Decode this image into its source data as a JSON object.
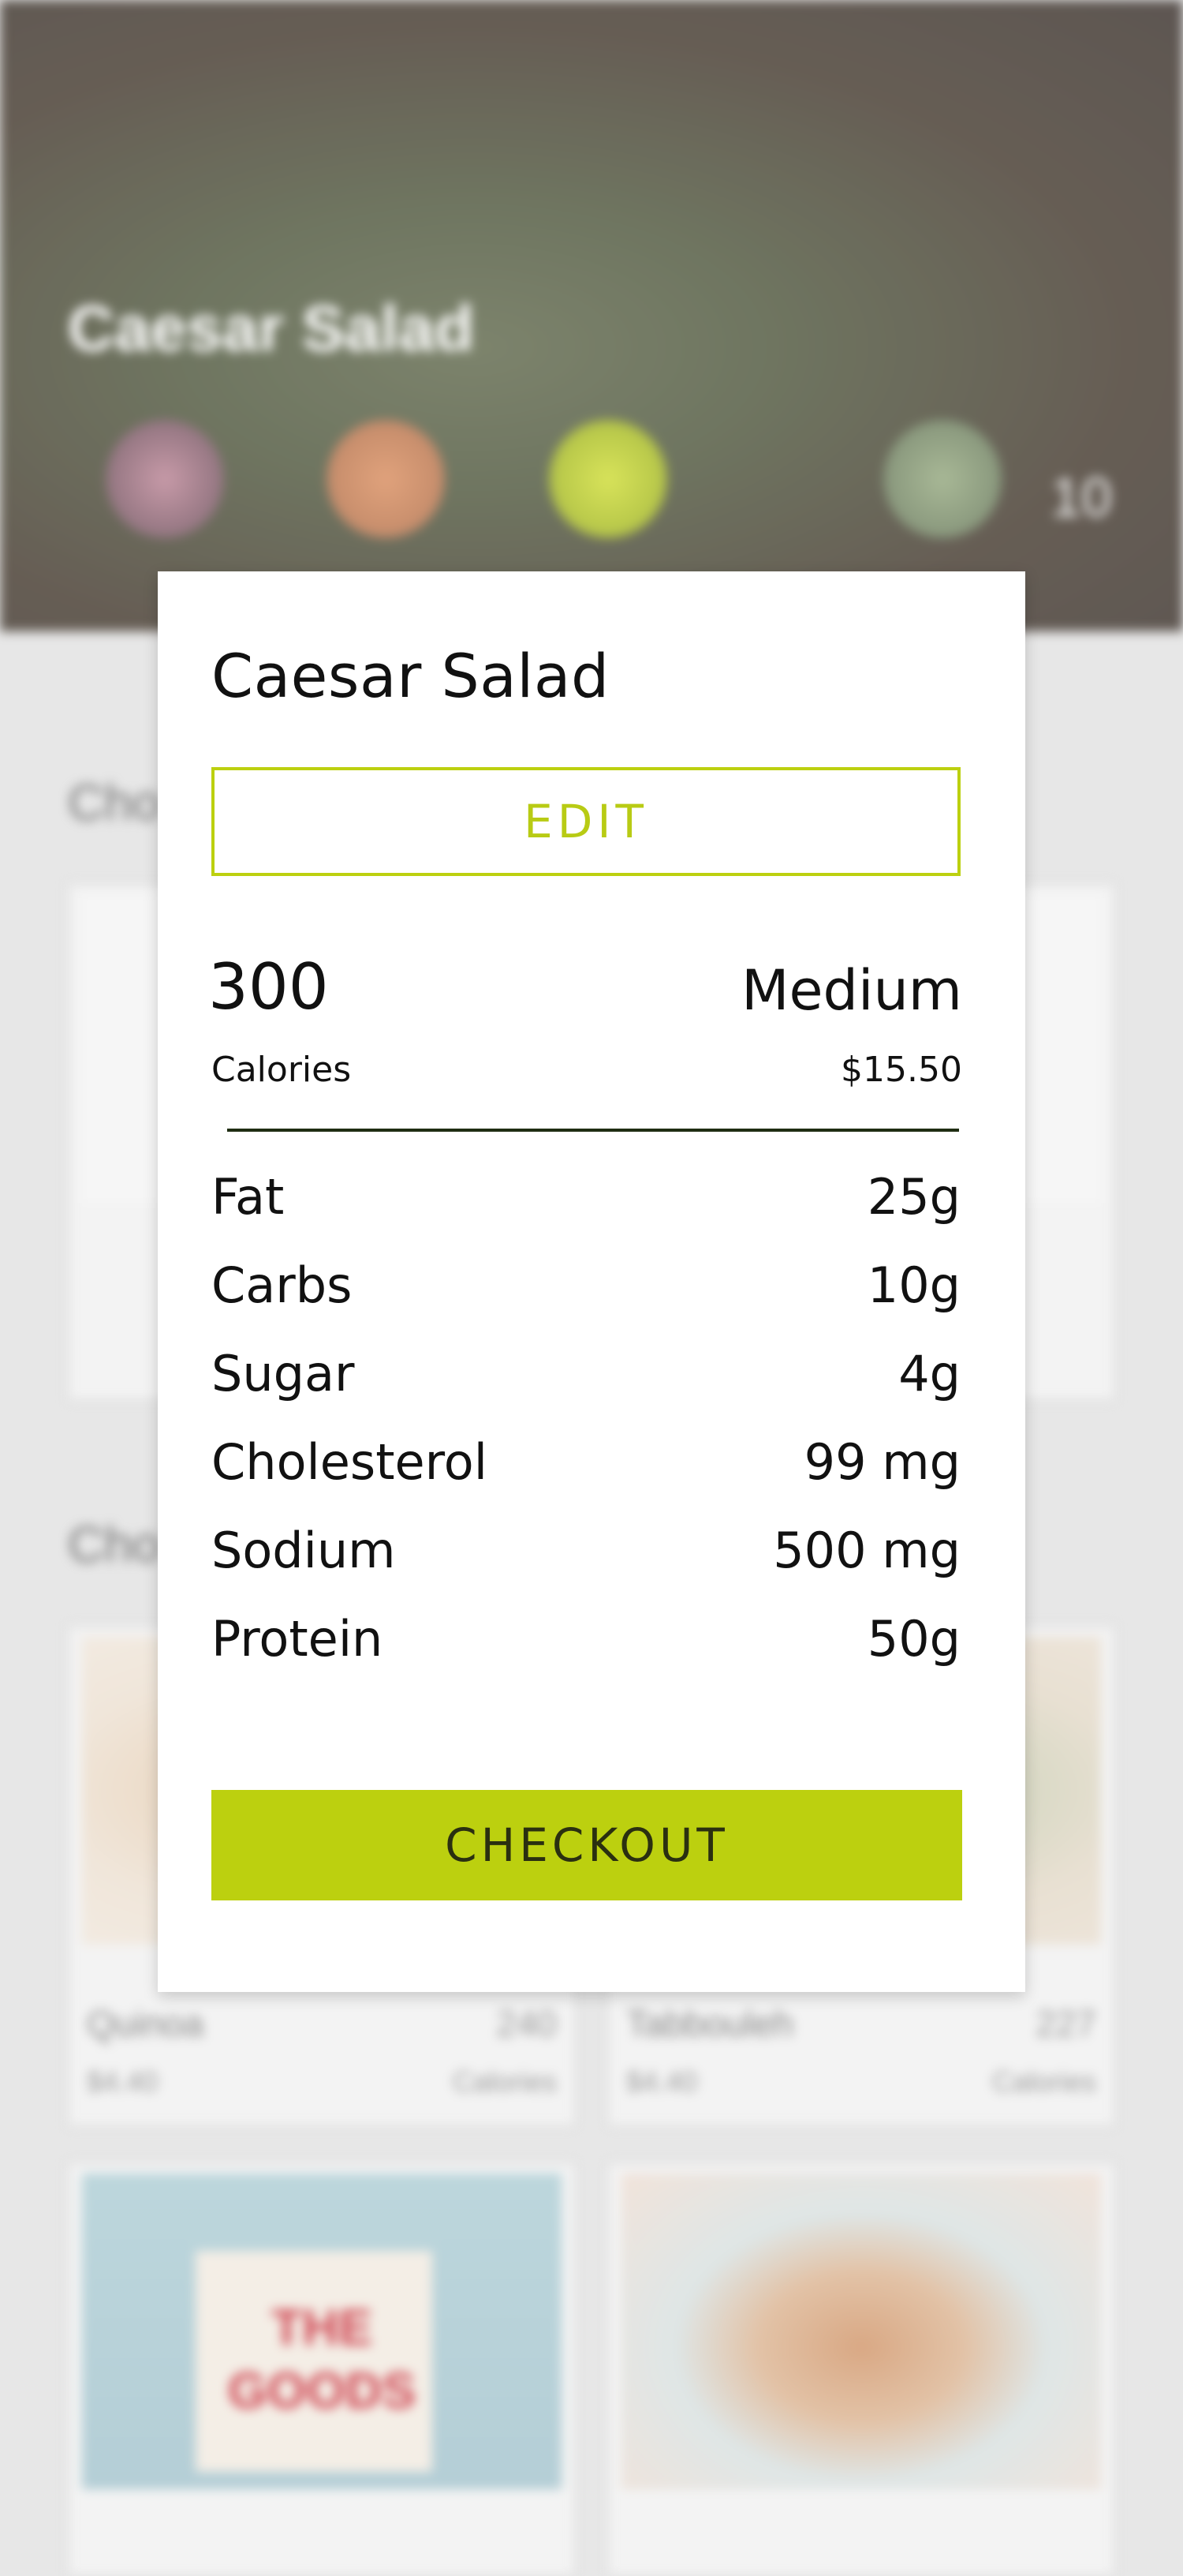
{
  "background": {
    "hero_title": "Caesar Salad",
    "hero_number": "10",
    "section_headings": [
      "Cho",
      "Cho"
    ],
    "cards": [
      {
        "name": "Quinoa",
        "price": "$4.40",
        "calories": "240",
        "calories_label": "Calories"
      },
      {
        "name": "Tabbouleh",
        "price": "$4.40",
        "calories": "227",
        "calories_label": "Calories"
      }
    ],
    "fries_text": [
      "THE",
      "GOODS"
    ]
  },
  "modal": {
    "title": "Caesar Salad",
    "edit_label": "EDIT",
    "calories_value": "300",
    "calories_label": "Calories",
    "size": "Medium",
    "price": "$15.50",
    "nutrition": [
      {
        "name": "Fat",
        "value": "25g"
      },
      {
        "name": "Carbs",
        "value": "10g"
      },
      {
        "name": "Sugar",
        "value": "4g"
      },
      {
        "name": "Cholesterol",
        "value": "99 mg"
      },
      {
        "name": "Sodium",
        "value": "500 mg"
      },
      {
        "name": "Protein",
        "value": "50g"
      }
    ],
    "checkout_label": "CHECKOUT"
  },
  "colors": {
    "accent": "#bcd00f",
    "divider": "#1f2d12"
  }
}
